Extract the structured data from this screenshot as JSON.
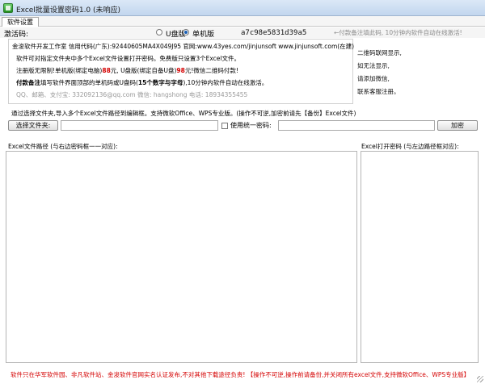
{
  "window": {
    "title": "Excel批量设置密码1.0 (未响应)"
  },
  "menu": {
    "tab_label": "软件设置"
  },
  "activation": {
    "label": "激活码:",
    "option_udisk": "U盘版",
    "option_standalone": "单机版",
    "selected": "单机版",
    "code": "a7c98e5831d39a5",
    "hint": "←付款备注填此码, 10分钟内软件自动在线激活!"
  },
  "info": {
    "line1": "金浚软件开发工作室  信用代码(广东):92440605MA4X049J95  官网:www.43yes.com/jinjunsoft   www.jinjunsoft.com(在建)",
    "line2": "软件可对指定文件夹中多个Excel文件设置打开密码。免费版只设置3个Excel文件。",
    "line3_a": "注册版无限制!单机版(绑定电脑)",
    "line3_price1": "88",
    "line3_b": "元, U盘版(绑定自备U盘)",
    "line3_price2": "98",
    "line3_c": "元!微信二维码付款!",
    "line4_bold": "付款备注",
    "line4_a": "填写软件界面顶部的单机码或U盘码(",
    "line4_bold2": "15个数字与字母",
    "line4_b": "),10分钟内软件自动在线激活。",
    "line5": "QQ、邮箱、支付宝: 332092136@qq.com   微信: hangshong   电话: 18934355455"
  },
  "side_links": [
    "二维码联网显示,",
    "如无法显示,",
    "请添加微信,",
    "联系客服注册。"
  ],
  "description": "通过选择文件夹,导入多个Excel文件路径到编辑框。支持微软Office、WPS专业版。(操作不可逆,加密前请先【备份】Excel文件)",
  "controls": {
    "select_folder_label": "选择文件夹:",
    "folder_path_value": "",
    "use_single_password_label": "使用统一密码:",
    "password_value": "",
    "encrypt_label": "加密"
  },
  "panels": {
    "left_title": "Excel文件路径 (与右边密码框一一对应):",
    "right_title": "Excel打开密码 (与左边路径框对应):"
  },
  "footer": {
    "text": "软件只在华军软件园、非凡软件站、金浚软件官网实名认证发布,不对其他下载途径负责! 【操作不可逆,操作前请备份,并关闭所有excel文件,支持微软Office、WPS专业版】"
  },
  "colors": {
    "warning_red": "#d40000",
    "hint_grey": "#8a8a8a",
    "accent_blue": "#1a5fb4"
  }
}
